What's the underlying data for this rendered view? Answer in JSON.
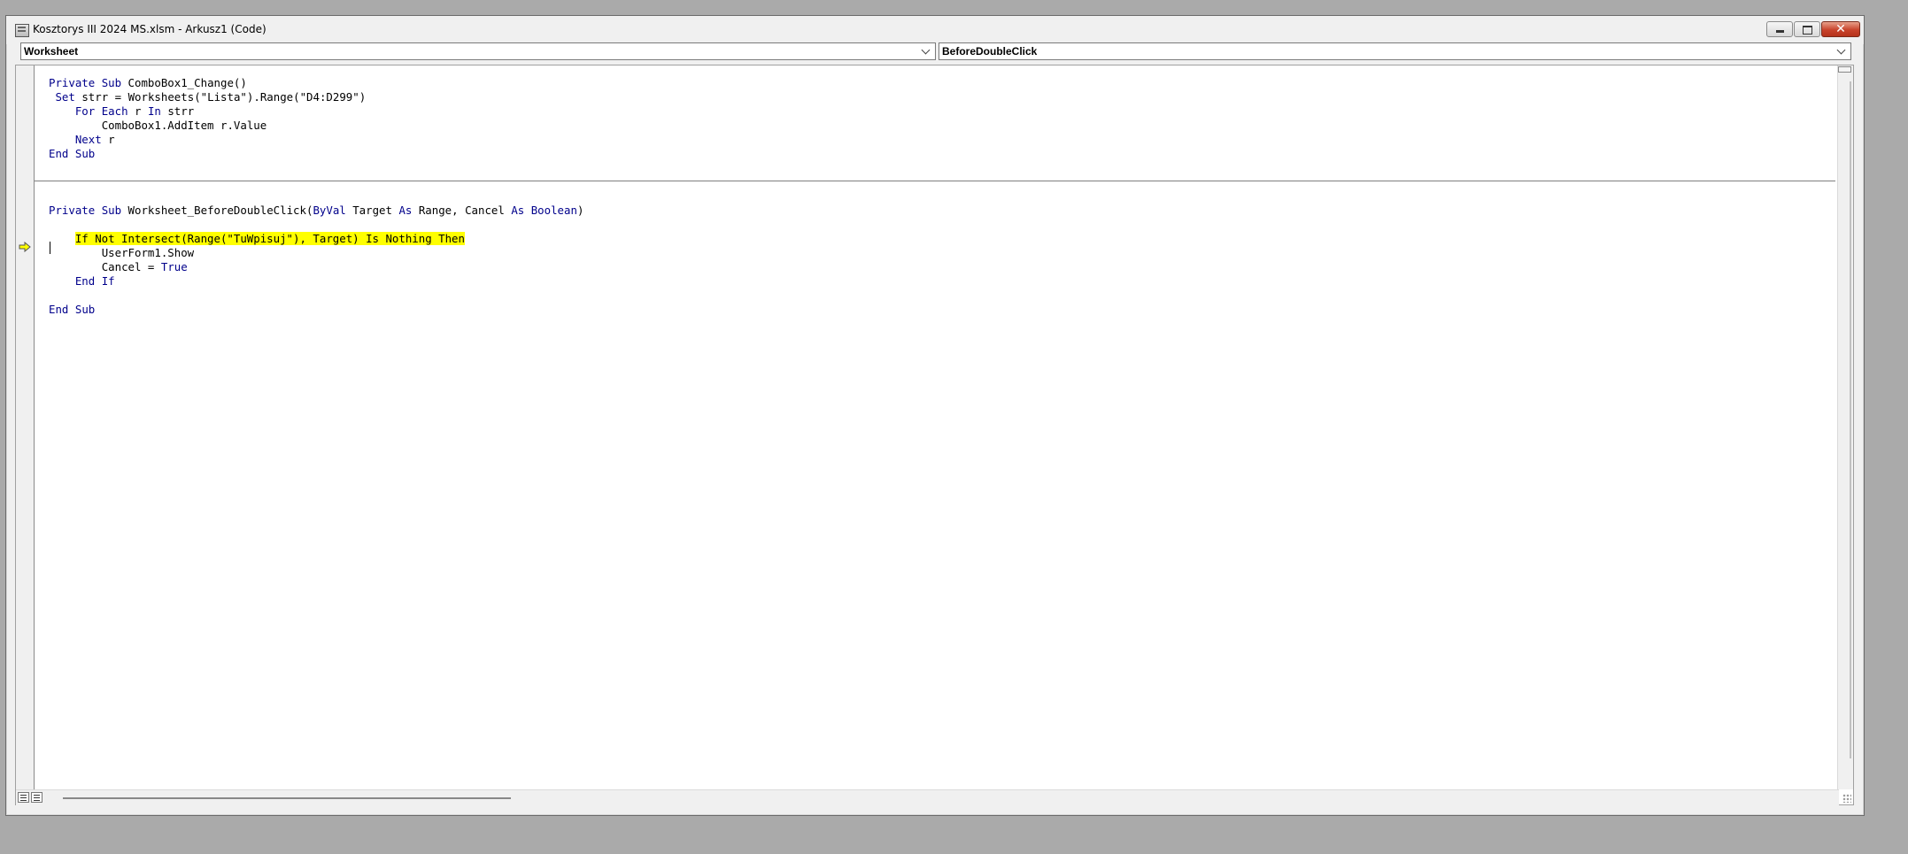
{
  "window": {
    "title": "Kosztorys III 2024 MS.xlsm - Arkusz1 (Code)",
    "close_glyph": "✕"
  },
  "object_combo": {
    "value": "Worksheet"
  },
  "procedure_combo": {
    "value": "BeforeDoubleClick"
  },
  "code": {
    "lines": [
      "Private Sub ComboBox1_Change()",
      " Set strr = Worksheets(\"Lista\").Range(\"D4:D299\")",
      "    For Each r In strr",
      "        ComboBox1.AddItem r.Value",
      "    Next r",
      "End Sub",
      "",
      "",
      "",
      "Private Sub Worksheet_BeforeDoubleClick(ByVal Target As Range, Cancel As Boolean)",
      "",
      "    If Not Intersect(Range(\"TuWpisuj\"), Target) Is Nothing Then",
      "        UserForm1.Show",
      "        Cancel = True",
      "    End If",
      "",
      "End Sub"
    ],
    "highlighted_line_index": 11,
    "keywords": [
      "Private",
      "Sub",
      "Set",
      "For",
      "Each",
      "In",
      "Next",
      "End",
      "ByVal",
      "As",
      "Boolean",
      "If",
      "Not",
      "Is",
      "Nothing",
      "Then",
      "True"
    ]
  },
  "colors": {
    "keyword": "#00008b",
    "highlight": "#ffff00",
    "execution_arrow": "#ffff00"
  },
  "icons": {
    "app": "vbe-module-icon",
    "execution": "execution-pointer-arrow-icon"
  }
}
